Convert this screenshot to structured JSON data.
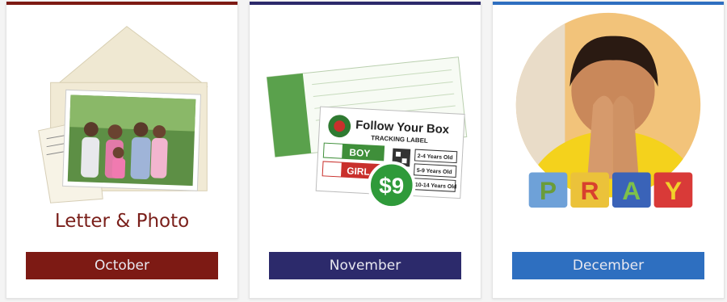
{
  "colors": {
    "october": "#7d1a14",
    "november": "#2c2a6b",
    "december": "#2e6fc0",
    "caption": "#7a1f1a",
    "label_green": "#3f8f3a",
    "label_red": "#c9302c"
  },
  "cards": [
    {
      "caption": "Letter & Photo",
      "month": "October",
      "image": "envelope-with-family-photo"
    },
    {
      "caption": "",
      "month": "November",
      "image": "tracking-label",
      "label": {
        "title": "Follow Your Box",
        "subtitle": "TRACKING LABEL",
        "boy": "BOY",
        "girl": "GIRL",
        "price": "$9",
        "ages": [
          "2-4 Years Old",
          "5-9 Years Old",
          "10-14 Years Old"
        ]
      }
    },
    {
      "caption": "",
      "month": "December",
      "image": "child-praying",
      "blocks": [
        "P",
        "R",
        "A",
        "Y"
      ]
    }
  ]
}
